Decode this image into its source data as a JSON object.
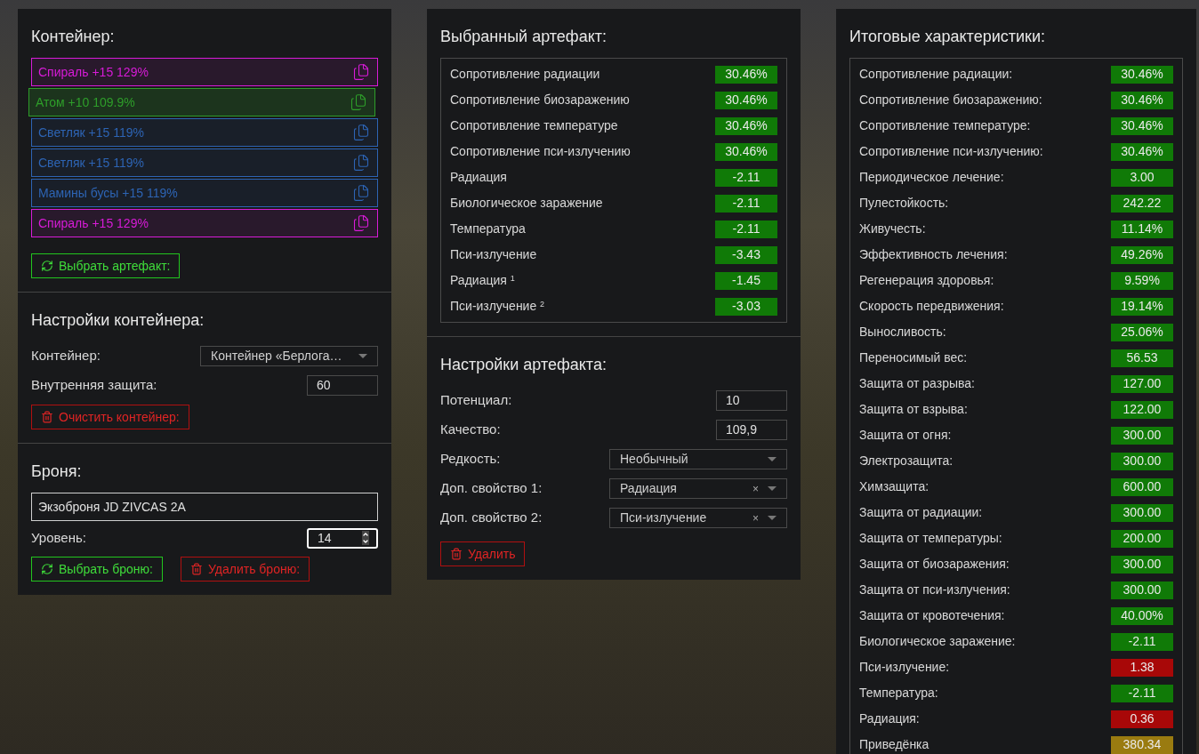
{
  "container_panel": {
    "title": "Контейнер:",
    "items": [
      {
        "label": "Спираль +15 129%",
        "color": "#d81bd8",
        "selected": false
      },
      {
        "label": "Атом +10 109.9%",
        "color": "#2e9e2a",
        "selected": true
      },
      {
        "label": "Светляк +15 119%",
        "color": "#2d64b4",
        "selected": false
      },
      {
        "label": "Светляк +15 119%",
        "color": "#2d64b4",
        "selected": false
      },
      {
        "label": "Мамины бусы +15 119%",
        "color": "#2d64b4",
        "selected": false
      },
      {
        "label": "Спираль +15 129%",
        "color": "#d81bd8",
        "selected": false
      }
    ],
    "button": {
      "kind": "select",
      "label": "Выбрать артефакт:"
    }
  },
  "container_settings": {
    "title": "Настройки контейнера:",
    "fields": [
      {
        "kind": "select",
        "label": "Контейнер:",
        "value": "Контейнер «Берлога…",
        "clearable": false
      },
      {
        "kind": "input",
        "label": "Внутренняя защита:",
        "value": "60"
      }
    ],
    "button": {
      "kind": "delete",
      "label": "Очистить контейнер:"
    }
  },
  "armor": {
    "title": "Броня:",
    "name_value": "Экзоброня JD ZIVCAS 2A",
    "level": {
      "label": "Уровень:",
      "value": "14",
      "focused": true
    },
    "buttons": [
      {
        "kind": "select",
        "label": "Выбрать броню:"
      },
      {
        "kind": "delete",
        "label": "Удалить броню:"
      }
    ]
  },
  "selected_artifact": {
    "title": "Выбранный артефакт:",
    "stats": [
      {
        "name": "Сопротивление радиации",
        "value": "30.46%",
        "color": "#107a07"
      },
      {
        "name": "Сопротивление биозаражению",
        "value": "30.46%",
        "color": "#107a07"
      },
      {
        "name": "Сопротивление температуре",
        "value": "30.46%",
        "color": "#107a07"
      },
      {
        "name": "Сопротивление пси-излучению",
        "value": "30.46%",
        "color": "#107a07"
      },
      {
        "name": "Радиация",
        "value": "-2.11",
        "color": "#107a07"
      },
      {
        "name": "Биологическое заражение",
        "value": "-2.11",
        "color": "#107a07"
      },
      {
        "name": "Температура",
        "value": "-2.11",
        "color": "#107a07"
      },
      {
        "name": "Пси-излучение",
        "value": "-3.43",
        "color": "#107a07"
      },
      {
        "name": "Радиация $^{1}$",
        "value": "-1.45",
        "color": "#107a07"
      },
      {
        "name": "Пси-излучение $^{2}$",
        "value": "-3.03",
        "color": "#107a07"
      }
    ]
  },
  "artifact_settings": {
    "title": "Настройки артефакта:",
    "fields": [
      {
        "kind": "input",
        "label": "Потенциал:",
        "value": "10"
      },
      {
        "kind": "input",
        "label": "Качество:",
        "value": "109,9"
      },
      {
        "kind": "select",
        "label": "Редкость:",
        "value": "Необычный",
        "clearable": false
      },
      {
        "kind": "select",
        "label": "Доп. свойство 1:",
        "value": "Радиация",
        "clearable": true
      },
      {
        "kind": "select",
        "label": "Доп. свойство 2:",
        "value": "Пси-излучение",
        "clearable": true
      }
    ],
    "clear_mark": "×",
    "button": {
      "kind": "delete",
      "label": "Удалить"
    }
  },
  "totals": {
    "title": "Итоговые характеристики:",
    "stats": [
      {
        "name": "Сопротивление радиации:",
        "value": "30.46%",
        "color": "#107a07"
      },
      {
        "name": "Сопротивление биозаражению:",
        "value": "30.46%",
        "color": "#107a07"
      },
      {
        "name": "Сопротивление температуре:",
        "value": "30.46%",
        "color": "#107a07"
      },
      {
        "name": "Сопротивление пси-излучению:",
        "value": "30.46%",
        "color": "#107a07"
      },
      {
        "name": "Периодическое лечение:",
        "value": "3.00",
        "color": "#107a07"
      },
      {
        "name": "Пулестойкость:",
        "value": "242.22",
        "color": "#107a07"
      },
      {
        "name": "Живучесть:",
        "value": "11.14%",
        "color": "#107a07"
      },
      {
        "name": "Эффективность лечения:",
        "value": "49.26%",
        "color": "#107a07"
      },
      {
        "name": "Регенерация здоровья:",
        "value": "9.59%",
        "color": "#107a07"
      },
      {
        "name": "Скорость передвижения:",
        "value": "19.14%",
        "color": "#107a07"
      },
      {
        "name": "Выносливость:",
        "value": "25.06%",
        "color": "#107a07"
      },
      {
        "name": "Переносимый вес:",
        "value": "56.53",
        "color": "#107a07"
      },
      {
        "name": "Защита от разрыва:",
        "value": "127.00",
        "color": "#107a07"
      },
      {
        "name": "Защита от взрыва:",
        "value": "122.00",
        "color": "#107a07"
      },
      {
        "name": "Защита от огня:",
        "value": "300.00",
        "color": "#107a07"
      },
      {
        "name": "Электрозащита:",
        "value": "300.00",
        "color": "#107a07"
      },
      {
        "name": "Химзащита:",
        "value": "600.00",
        "color": "#107a07"
      },
      {
        "name": "Защита от радиации:",
        "value": "300.00",
        "color": "#107a07"
      },
      {
        "name": "Защита от температуры:",
        "value": "200.00",
        "color": "#107a07"
      },
      {
        "name": "Защита от биозаражения:",
        "value": "300.00",
        "color": "#107a07"
      },
      {
        "name": "Защита от пси-излучения:",
        "value": "300.00",
        "color": "#107a07"
      },
      {
        "name": "Защита от кровотечения:",
        "value": "40.00%",
        "color": "#107a07"
      },
      {
        "name": "Биологическое заражение:",
        "value": "-2.11",
        "color": "#107a07"
      },
      {
        "name": "Пси-излучение:",
        "value": "1.38",
        "color": "#a80808"
      },
      {
        "name": "Температура:",
        "value": "-2.11",
        "color": "#107a07"
      },
      {
        "name": "Радиация:",
        "value": "0.36",
        "color": "#a80808"
      },
      {
        "name": "Приведёнка",
        "value": "380.34",
        "color": "#9a7b10"
      }
    ]
  }
}
